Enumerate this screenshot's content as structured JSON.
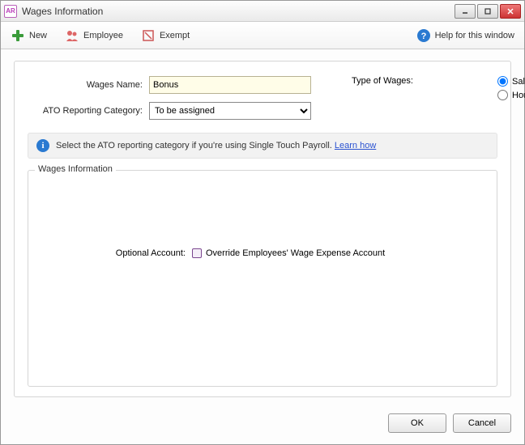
{
  "titlebar": {
    "app_badge": "AR",
    "title": "Wages Information"
  },
  "toolbar": {
    "new_label": "New",
    "employee_label": "Employee",
    "exempt_label": "Exempt",
    "help_label": "Help for this window"
  },
  "form": {
    "wages_name_label": "Wages Name:",
    "wages_name_value": "Bonus",
    "ato_category_label": "ATO Reporting Category:",
    "ato_category_value": "To be assigned",
    "type_of_wages_label": "Type of Wages:",
    "radio_salary": "Salary",
    "radio_hourly": "Hourly",
    "radio_selected": "salary"
  },
  "info": {
    "text": "Select the ATO reporting category if you're using Single Touch Payroll. ",
    "link": "Learn how"
  },
  "group": {
    "legend": "Wages Information",
    "optional_label": "Optional Account:",
    "override_label": "Override Employees' Wage Expense Account"
  },
  "footer": {
    "ok": "OK",
    "cancel": "Cancel"
  }
}
